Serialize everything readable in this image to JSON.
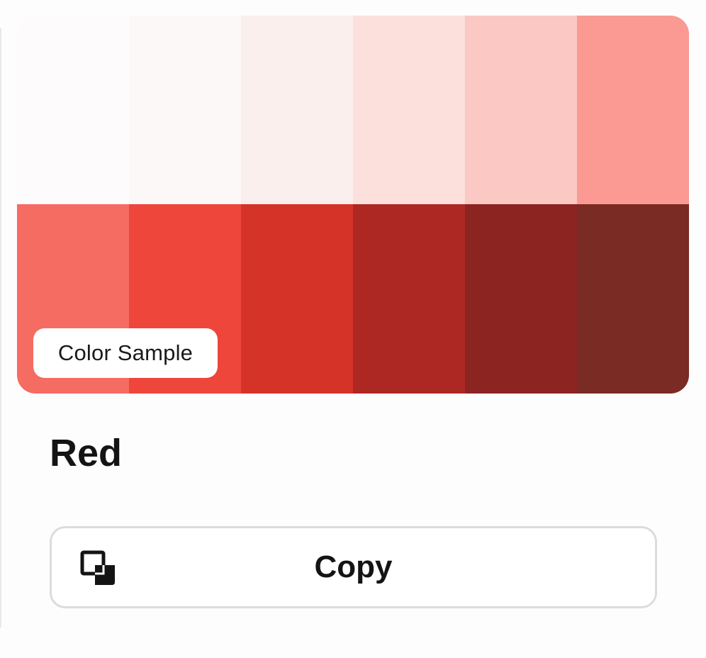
{
  "swatches": {
    "colors": [
      "#fdfbfb",
      "#fcf8f7",
      "#fbefed",
      "#fce0dc",
      "#fbc8c3",
      "#fa9a92",
      "#f56c63",
      "#ee463b",
      "#d53228",
      "#ad2822",
      "#8c2421",
      "#7a2b24"
    ],
    "badge_label": "Color Sample"
  },
  "color": {
    "name": "Red"
  },
  "actions": {
    "copy_label": "Copy",
    "copy_icon": "copy-icon"
  }
}
